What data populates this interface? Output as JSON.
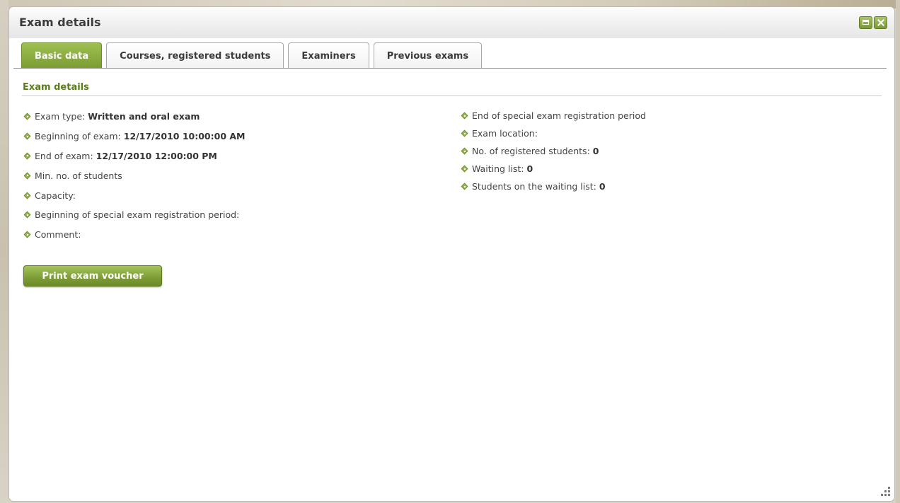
{
  "window": {
    "title": "Exam details"
  },
  "tabs": [
    {
      "label": "Basic data",
      "active": true
    },
    {
      "label": "Courses, registered students",
      "active": false
    },
    {
      "label": "Examiners",
      "active": false
    },
    {
      "label": "Previous exams",
      "active": false
    }
  ],
  "section": {
    "title": "Exam details"
  },
  "left_fields": [
    {
      "label": "Exam type:",
      "value": "Written and oral exam"
    },
    {
      "label": "Beginning of exam:",
      "value": "12/17/2010 10:00:00 AM"
    },
    {
      "label": "End of exam:",
      "value": "12/17/2010 12:00:00 PM"
    },
    {
      "label": "Min. no. of students",
      "value": ""
    },
    {
      "label": "Capacity:",
      "value": ""
    },
    {
      "label": "Beginning of special exam registration period:",
      "value": ""
    },
    {
      "label": "Comment:",
      "value": ""
    }
  ],
  "right_fields": [
    {
      "label": "End of special exam registration period",
      "value": ""
    },
    {
      "label": "Exam location:",
      "value": ""
    },
    {
      "label": "No. of registered students:",
      "value": "0"
    },
    {
      "label": "Waiting list:",
      "value": "0"
    },
    {
      "label": "Students on the waiting list:",
      "value": "0"
    }
  ],
  "actions": {
    "print_label": "Print exam voucher"
  },
  "colors": {
    "accent": "#7a9c30",
    "section_title": "#5b7d1a"
  },
  "icons": {
    "window_buttons": [
      "maximize-icon",
      "close-icon"
    ],
    "bullet": "diamond-bullet-icon",
    "resize": "resize-grip-icon"
  }
}
